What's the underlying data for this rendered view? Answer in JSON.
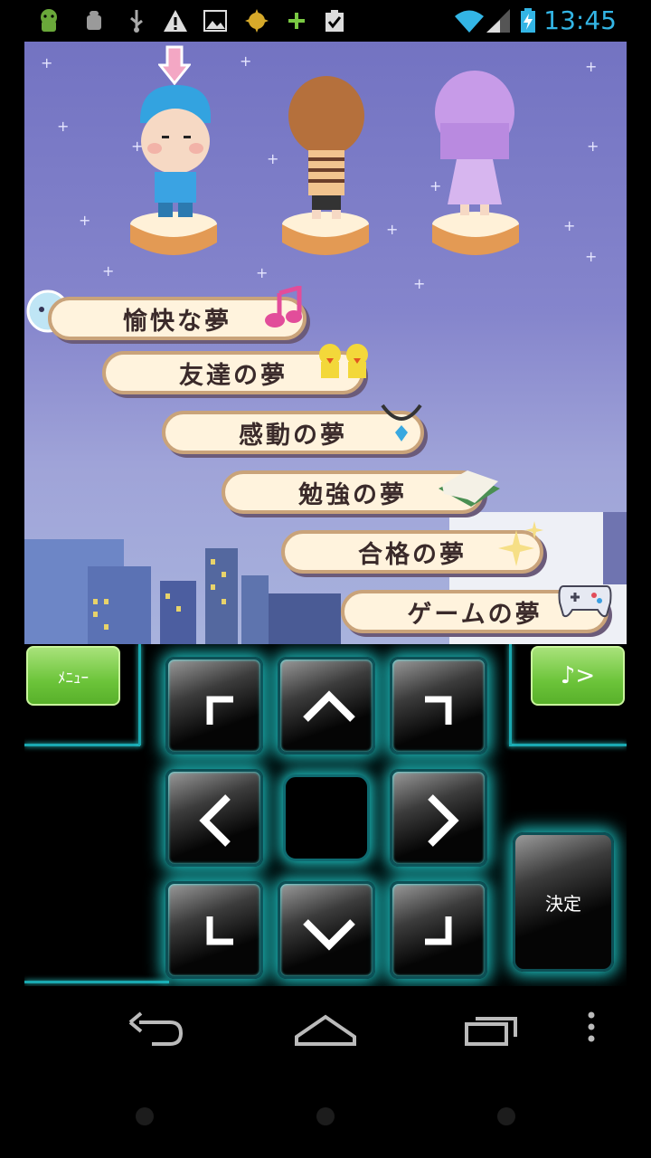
{
  "status_bar": {
    "time": "13:45",
    "icons": [
      "android-icon",
      "android-debug-icon",
      "usb-icon",
      "warning-icon",
      "picture-icon",
      "sun-badge-icon",
      "plus-icon",
      "clipboard-check-icon",
      "wifi-icon",
      "signal-icon",
      "battery-charging-icon"
    ]
  },
  "game": {
    "characters": [
      "boy-character",
      "girl-brown-hair-character",
      "girl-purple-hair-character"
    ],
    "selected_character_index": 0,
    "dream_options": [
      {
        "label": "愉快な夢",
        "icon": "music-note-icon",
        "selected": true
      },
      {
        "label": "友達の夢",
        "icon": "chicks-icon",
        "selected": false
      },
      {
        "label": "感動の夢",
        "icon": "necklace-icon",
        "selected": false
      },
      {
        "label": "勉強の夢",
        "icon": "open-book-icon",
        "selected": false
      },
      {
        "label": "合格の夢",
        "icon": "sparkle-icon",
        "selected": false
      },
      {
        "label": "ゲームの夢",
        "icon": "game-controller-icon",
        "selected": false
      }
    ]
  },
  "controls": {
    "menu_label": "ﾒﾆｭｰ",
    "sound_label": "♪>",
    "ok_label": "決定"
  },
  "colors": {
    "accent_cyan": "#1ec8c8",
    "status_blue": "#33b5e5",
    "button_green": "#6cc43a",
    "sky_purple": "#7373c2"
  }
}
